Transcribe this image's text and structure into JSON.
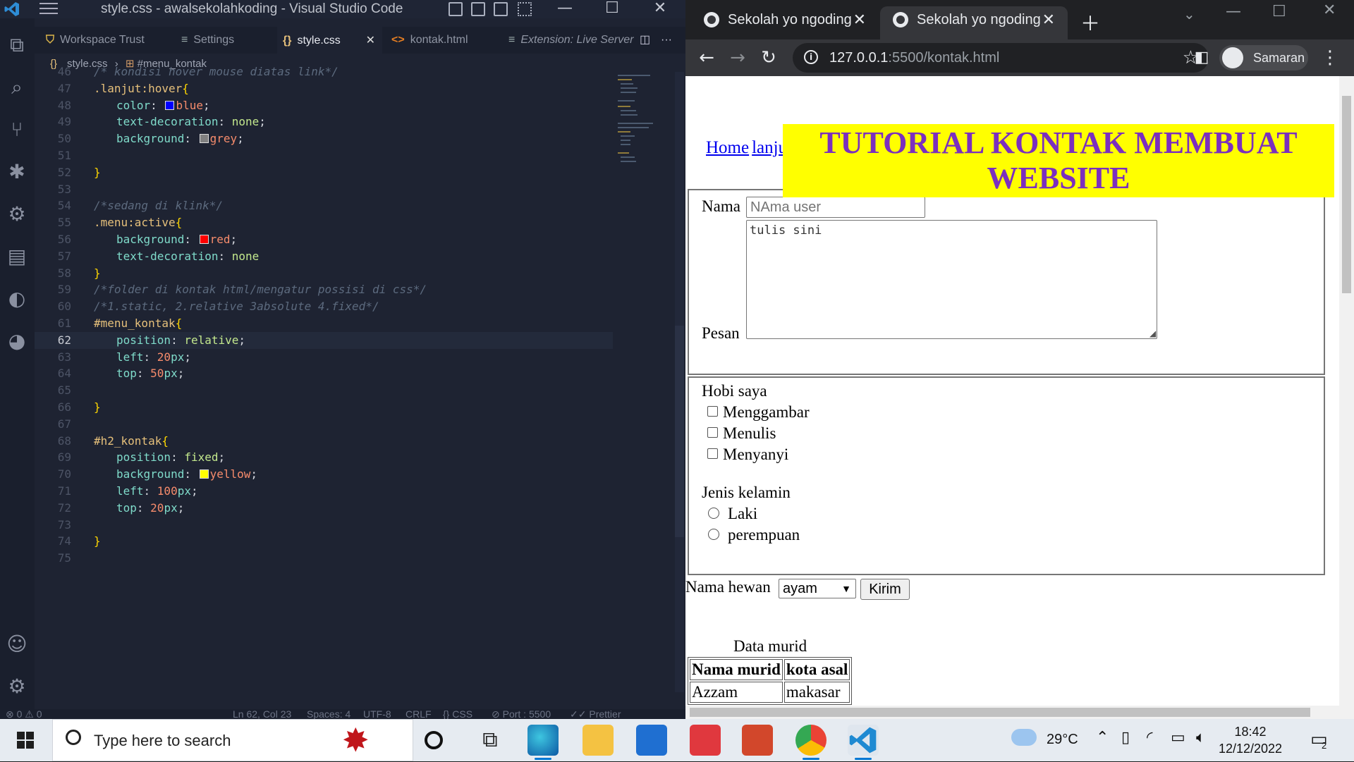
{
  "vscode": {
    "window_title": "style.css - awalsekolahkoding - Visual Studio Code",
    "tabs": [
      {
        "label": "Workspace Trust"
      },
      {
        "label": "Settings"
      },
      {
        "label": "style.css"
      },
      {
        "label": "kontak.html"
      },
      {
        "label": "Extension: Live Server"
      }
    ],
    "breadcrumb": {
      "file": "style.css",
      "symbol": "#menu_kontak"
    },
    "code_lines": [
      {
        "n": "46",
        "text": "/* kondisi hover mouse diatas link*/"
      },
      {
        "n": "47",
        "text": ".lanjut:hover{"
      },
      {
        "n": "48",
        "text": "color: blue;"
      },
      {
        "n": "49",
        "text": "text-decoration: none;"
      },
      {
        "n": "50",
        "text": "background: grey;"
      },
      {
        "n": "51",
        "text": ""
      },
      {
        "n": "52",
        "text": "}"
      },
      {
        "n": "53",
        "text": ""
      },
      {
        "n": "54",
        "text": "/*sedang di klink*/"
      },
      {
        "n": "55",
        "text": ".menu:active{"
      },
      {
        "n": "56",
        "text": "background: red;"
      },
      {
        "n": "57",
        "text": "text-decoration: none"
      },
      {
        "n": "58",
        "text": "}"
      },
      {
        "n": "59",
        "text": "/*folder di kontak html/mengatur possisi di css*/"
      },
      {
        "n": "60",
        "text": "/*1.static, 2.relative 3absolute 4.fixed*/"
      },
      {
        "n": "61",
        "text": "#menu_kontak{"
      },
      {
        "n": "62",
        "text": "position: relative;"
      },
      {
        "n": "63",
        "text": "left: 20px;"
      },
      {
        "n": "64",
        "text": "top: 50px;"
      },
      {
        "n": "65",
        "text": ""
      },
      {
        "n": "66",
        "text": "}"
      },
      {
        "n": "67",
        "text": ""
      },
      {
        "n": "68",
        "text": "#h2_kontak{"
      },
      {
        "n": "69",
        "text": "position: fixed;"
      },
      {
        "n": "70",
        "text": "background: yellow;"
      },
      {
        "n": "71",
        "text": "left: 100px;"
      },
      {
        "n": "72",
        "text": "top: 20px;"
      },
      {
        "n": "73",
        "text": ""
      },
      {
        "n": "74",
        "text": "}"
      },
      {
        "n": "75",
        "text": ""
      }
    ],
    "current_line": "62",
    "status": {
      "errors": "⊗ 0 ⚠ 0",
      "position": "Ln 62, Col 23",
      "spaces": "Spaces: 4",
      "encoding": "UTF-8",
      "eol": "CRLF",
      "language": "{} CSS",
      "port": "⊘ Port : 5500",
      "prettier": "✓✓ Prettier"
    }
  },
  "chrome": {
    "tabs": [
      {
        "label": "Sekolah yo ngoding"
      },
      {
        "label": "Sekolah yo ngoding"
      }
    ],
    "url_host": "127.0.0.1",
    "url_rest": ":5500/kontak.html",
    "profile": "Samaran",
    "page": {
      "links": [
        "Home",
        "lanju"
      ],
      "banner": "TUTORIAL KONTAK MEMBUAT WEBSITE",
      "nama_label": "Nama",
      "nama_placeholder": "NAma user",
      "pesan_label": "Pesan",
      "pesan_value": "tulis sini",
      "hobi_label": "Hobi saya",
      "hobi": [
        "Menggambar",
        "Menulis",
        "Menyanyi"
      ],
      "jk_label": "Jenis kelamin",
      "jk": [
        "Laki",
        "perempuan"
      ],
      "hewan_label": "Nama hewan",
      "hewan_selected": "ayam",
      "kirim": "Kirim",
      "table_caption": "Data murid",
      "table_headers": [
        "Nama murid",
        "kota asal"
      ],
      "table_rows": [
        [
          "Azzam",
          "makasar"
        ]
      ]
    }
  },
  "taskbar": {
    "search_placeholder": "Type here to search",
    "weather": "29°C",
    "time": "18:42",
    "date": "12/12/2022",
    "notifications": "2"
  }
}
